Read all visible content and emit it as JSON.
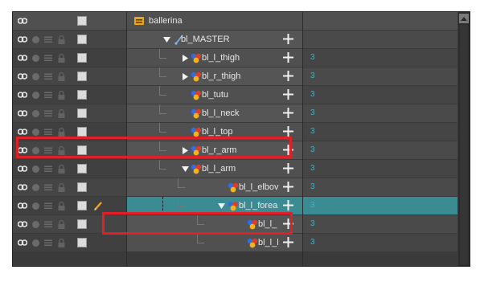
{
  "header": {
    "label": "ballerina"
  },
  "layers": [
    {
      "label": "bl_MASTER",
      "expand": "down",
      "glyph": "peg",
      "number": ""
    },
    {
      "label": "bl_l_thigh",
      "expand": "right",
      "glyph": "drawing",
      "number": "3"
    },
    {
      "label": "bl_r_thigh",
      "expand": "right",
      "glyph": "drawing",
      "number": "3"
    },
    {
      "label": "bl_tutu",
      "expand": "",
      "glyph": "drawing",
      "number": "3"
    },
    {
      "label": "bl_l_neck",
      "expand": "",
      "glyph": "drawing",
      "number": "3"
    },
    {
      "label": "bl_l_top",
      "expand": "",
      "glyph": "drawing",
      "number": "3"
    },
    {
      "label": "bl_r_arm",
      "expand": "right",
      "glyph": "drawing",
      "number": "3"
    },
    {
      "label": "bl_l_arm",
      "expand": "down",
      "glyph": "drawing",
      "number": "3"
    },
    {
      "label": "bl_l_elbov",
      "expand": "",
      "glyph": "drawing",
      "number": "3"
    },
    {
      "label": "bl_l_forea",
      "expand": "down",
      "glyph": "drawing",
      "number": "3"
    },
    {
      "label": "bl_l_",
      "expand": "",
      "glyph": "drawing",
      "number": "3"
    },
    {
      "label": "bl_l_l",
      "expand": "",
      "glyph": "drawing",
      "number": "3"
    }
  ],
  "colors": {
    "selection": "#3b8c92",
    "highlight": "#e11f26",
    "number": "#3fb3c4"
  },
  "icons": {
    "visibility": "visibility-icon",
    "add": "add-layer-icon",
    "lock": "lock-icon",
    "peg": "peg-icon",
    "drawing": "drawing-layer-icon"
  }
}
